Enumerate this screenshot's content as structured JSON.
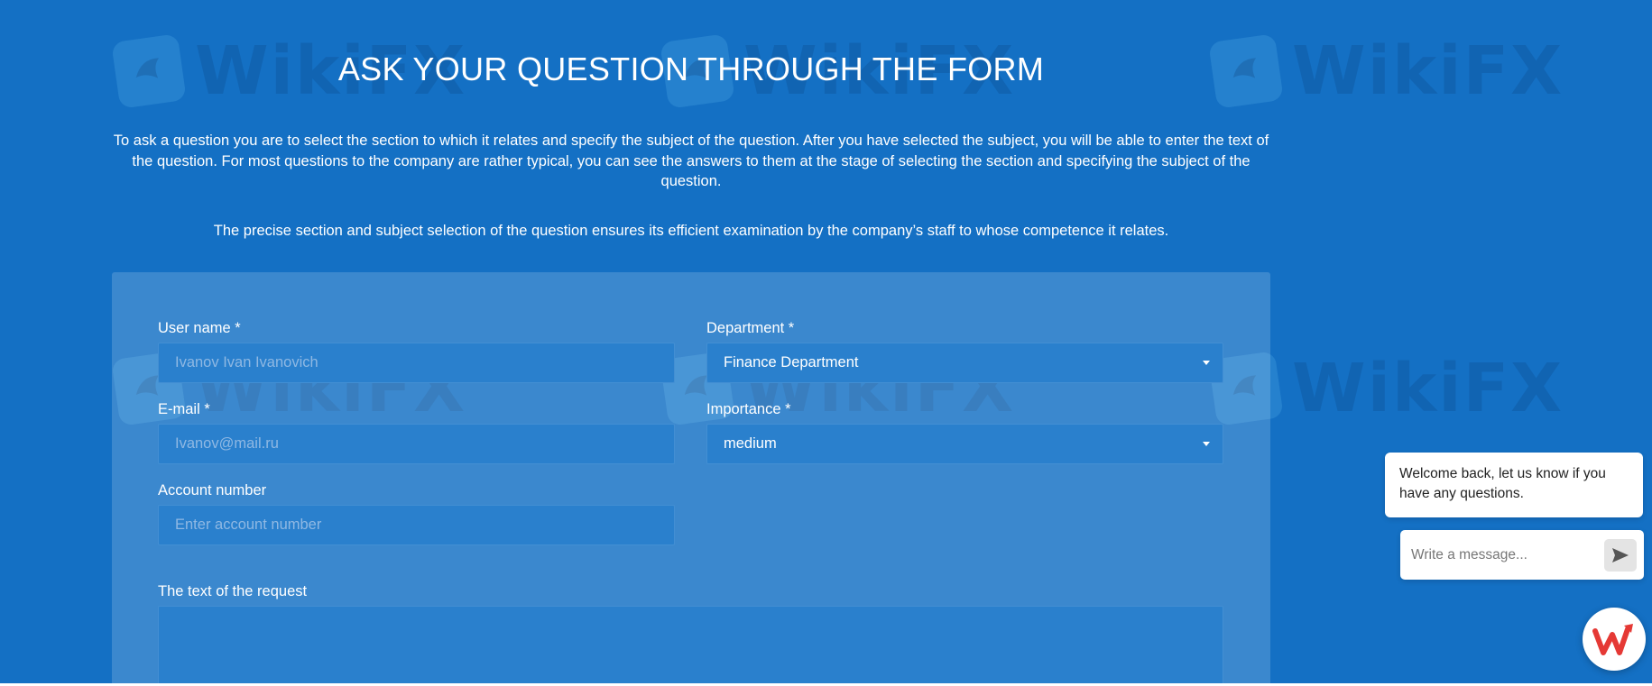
{
  "page": {
    "title": "ASK YOUR QUESTION THROUGH THE FORM",
    "intro": "To ask a question you are to select the section to which it relates and specify the subject of the question. After you have selected the subject, you will be able to enter the text of the question. For most questions to the company are rather typical, you can see the answers to them at the stage of selecting the section and specifying the subject of the question.",
    "intro2": "The precise section and subject selection of the question ensures its efficient examination by the company’s staff to whose competence it relates."
  },
  "watermark": {
    "text": "WikiFX"
  },
  "form": {
    "user_name": {
      "label": "User name *",
      "placeholder": "Ivanov Ivan Ivanovich"
    },
    "email": {
      "label": "E-mail *",
      "placeholder": "Ivanov@mail.ru"
    },
    "account": {
      "label": "Account number",
      "placeholder": "Enter account number"
    },
    "department": {
      "label": "Department *",
      "value": "Finance Department"
    },
    "importance": {
      "label": "Importance *",
      "value": "medium"
    },
    "request": {
      "label": "The text of the request"
    }
  },
  "chat": {
    "message": "Welcome back, let us know if you have any questions.",
    "input_placeholder": "Write a message...",
    "send_icon": "send-icon",
    "launcher_icon": "wikifx-logo-icon"
  },
  "colors": {
    "background": "#1470c4",
    "field": "#2a80cd",
    "launcher_red": "#e53935"
  }
}
